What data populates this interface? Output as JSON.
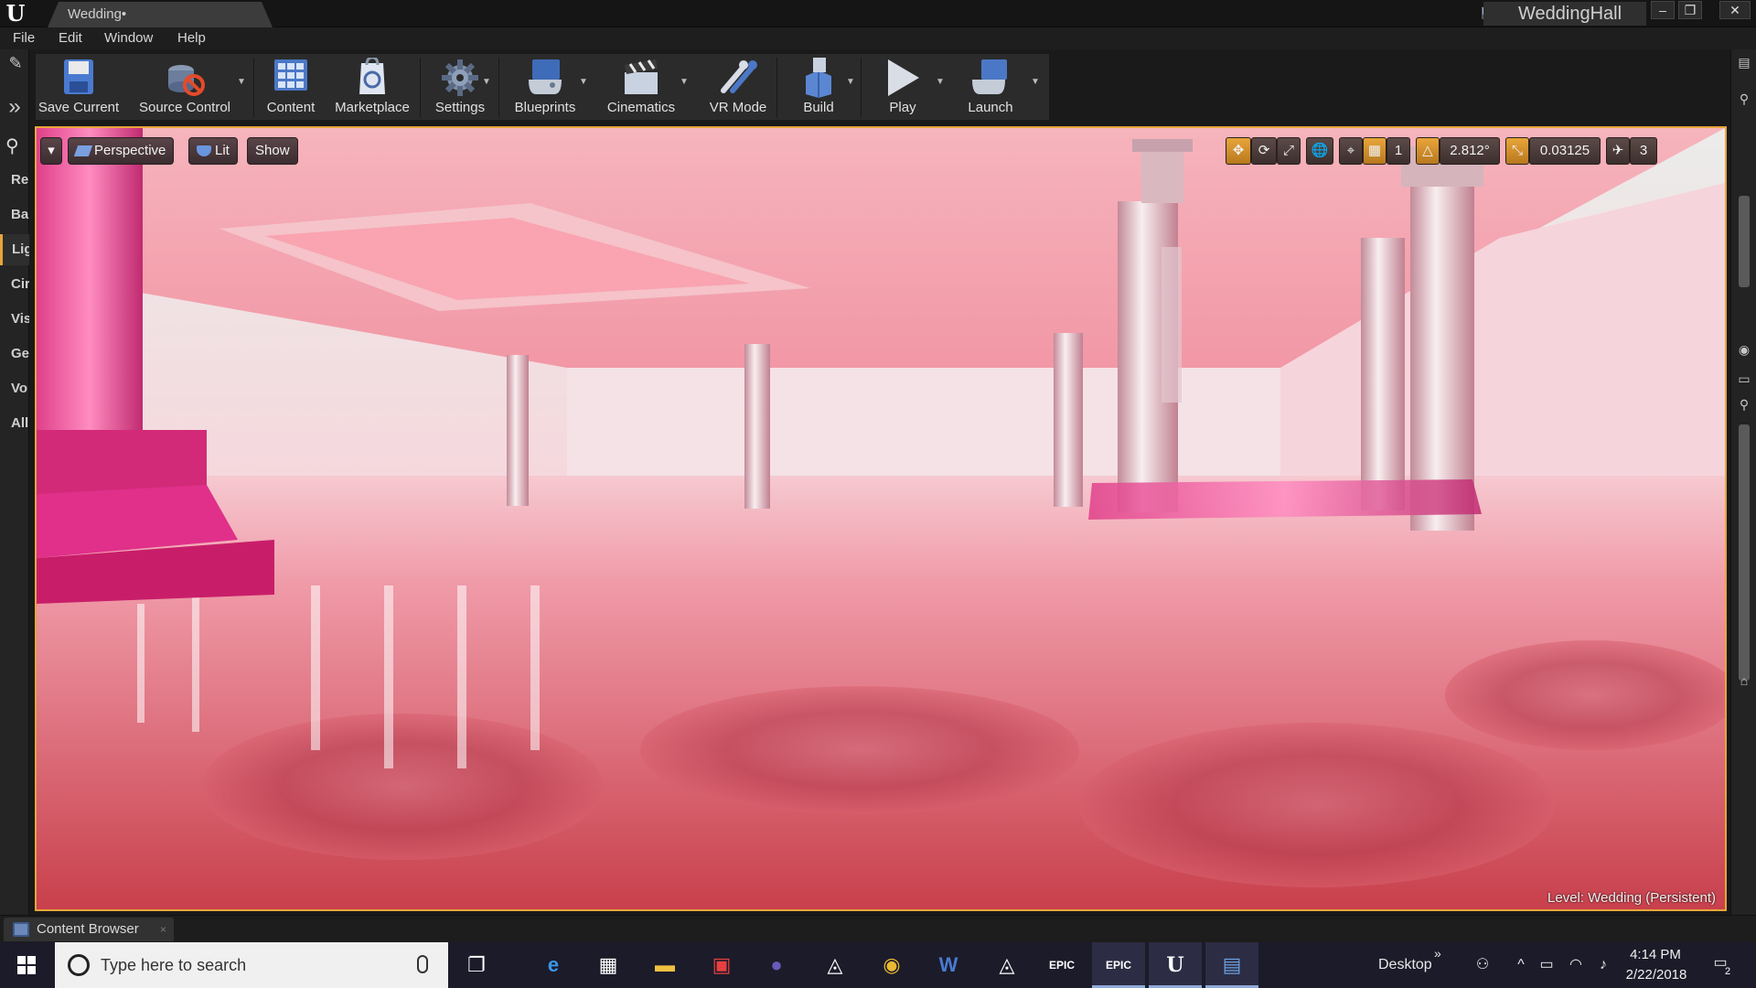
{
  "window": {
    "tab_title": "Wedding•",
    "project_name": "WeddingHall",
    "min": "–",
    "max": "❐",
    "close": "✕"
  },
  "menu": [
    "File",
    "Edit",
    "Window",
    "Help"
  ],
  "place_tabs": [
    "Re",
    "Ba",
    "Lig",
    "Cir",
    "Vis",
    "Ge",
    "Vo",
    "All"
  ],
  "toolbar": {
    "save_current": "Save Current",
    "source_control": "Source Control",
    "content": "Content",
    "marketplace": "Marketplace",
    "settings": "Settings",
    "blueprints": "Blueprints",
    "cinematics": "Cinematics",
    "vr_mode": "VR Mode",
    "build": "Build",
    "play": "Play",
    "launch": "Launch"
  },
  "viewport": {
    "view_mode": "Perspective",
    "lighting_mode": "Lit",
    "show": "Show",
    "rotation_snap": "2.812°",
    "scale_snap": "0.03125",
    "camera_speed": "3",
    "level_label": "Level:  Wedding (Persistent)"
  },
  "bottom": {
    "content_browser_tab": "Content Browser",
    "close": "×"
  },
  "taskbar": {
    "search_placeholder": "Type here to search",
    "desktop": "Desktop",
    "time": "4:14 PM",
    "date": "2/22/2018",
    "notifications": "2"
  }
}
